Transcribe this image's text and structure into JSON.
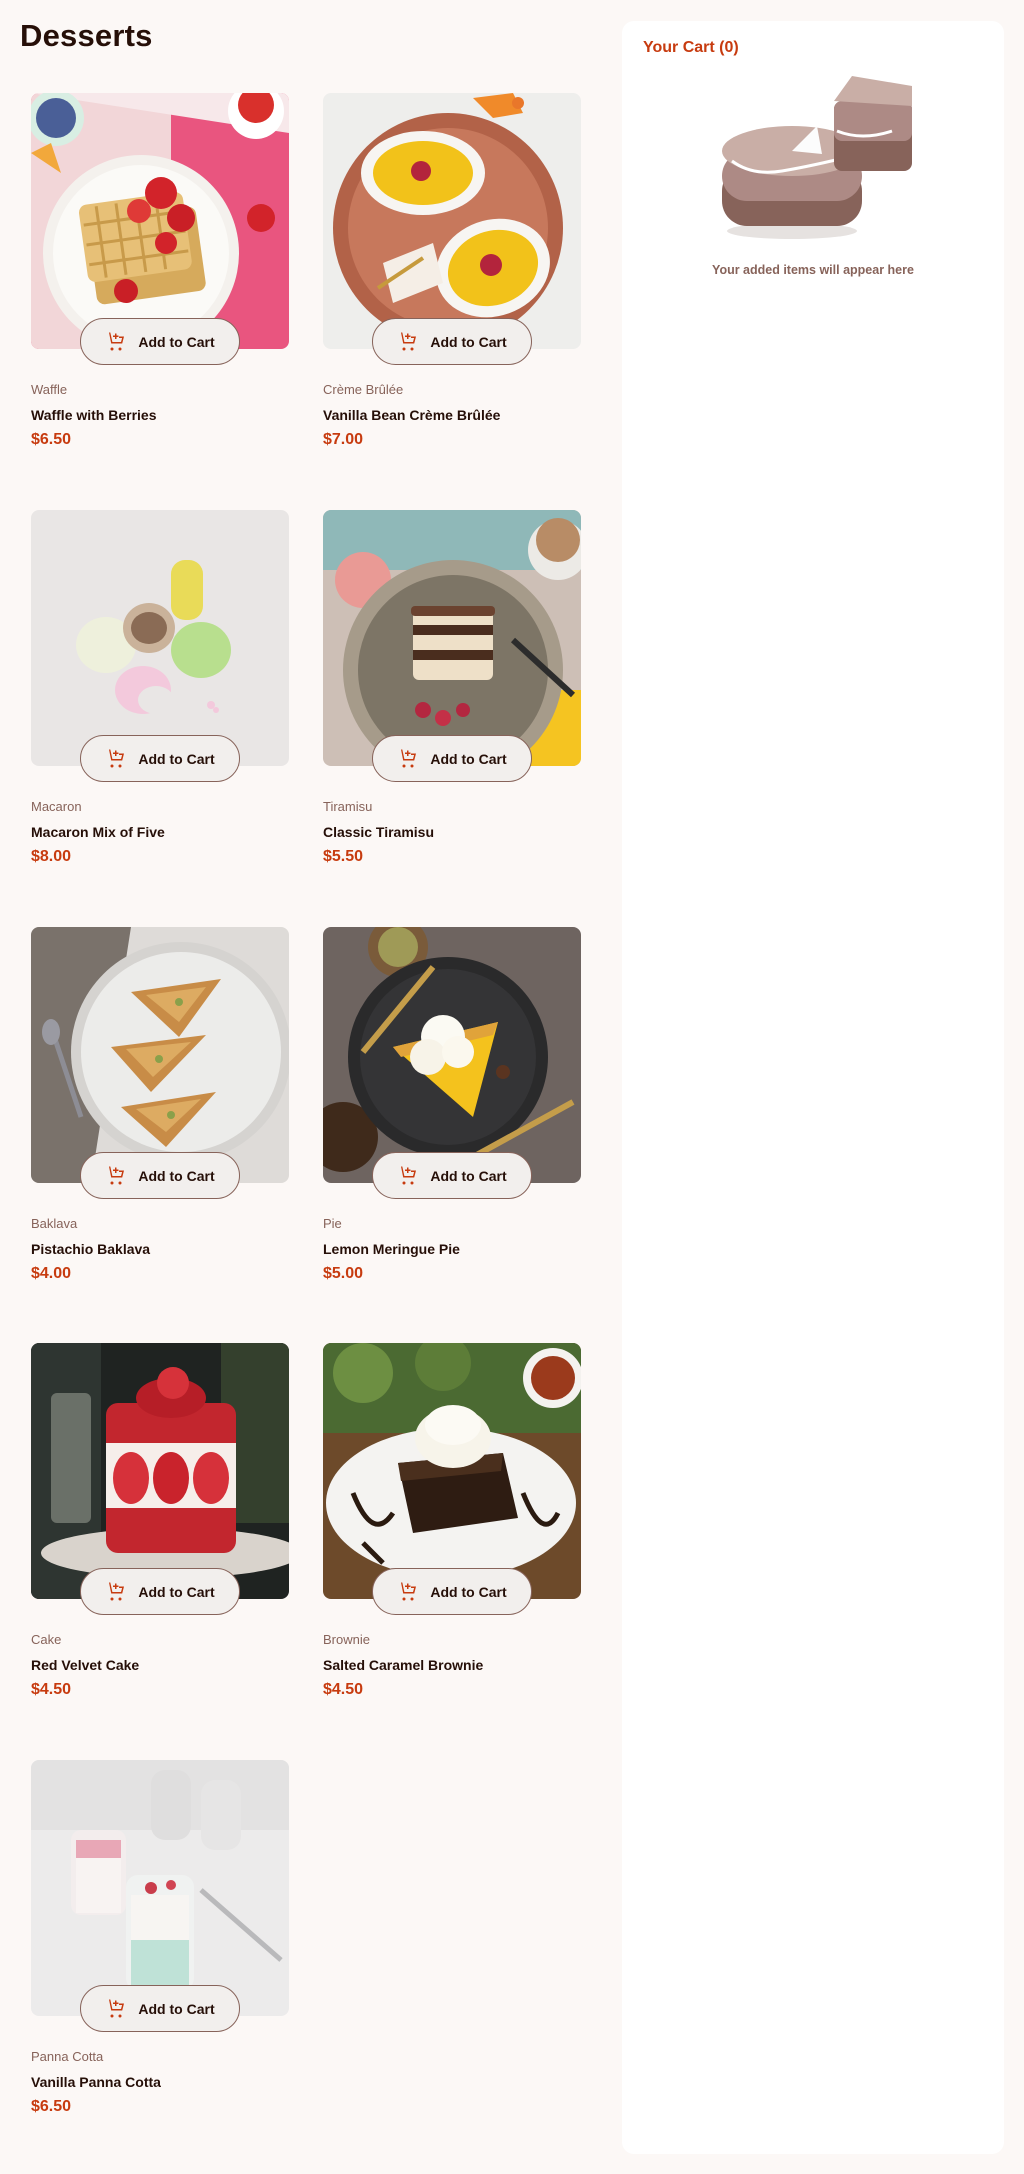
{
  "page": {
    "title": "Desserts"
  },
  "colors": {
    "accent": "#c73b0f",
    "text": "#260f08",
    "muted": "#87635a",
    "background": "#fcf8f6"
  },
  "add_to_cart_label": "Add to Cart",
  "products": [
    {
      "category": "Waffle",
      "name": "Waffle with Berries",
      "price": "$6.50"
    },
    {
      "category": "Crème Brûlée",
      "name": "Vanilla Bean Crème Brûlée",
      "price": "$7.00"
    },
    {
      "category": "Macaron",
      "name": "Macaron Mix of Five",
      "price": "$8.00"
    },
    {
      "category": "Tiramisu",
      "name": "Classic Tiramisu",
      "price": "$5.50"
    },
    {
      "category": "Baklava",
      "name": "Pistachio Baklava",
      "price": "$4.00"
    },
    {
      "category": "Pie",
      "name": "Lemon Meringue Pie",
      "price": "$5.00"
    },
    {
      "category": "Cake",
      "name": "Red Velvet Cake",
      "price": "$4.50"
    },
    {
      "category": "Brownie",
      "name": "Salted Caramel Brownie",
      "price": "$4.50"
    },
    {
      "category": "Panna Cotta",
      "name": "Vanilla Panna Cotta",
      "price": "$6.50"
    }
  ],
  "cart": {
    "title": "Your Cart (0)",
    "empty_message": "Your added items will appear here",
    "illustration_icon": "empty-cart-cake-illustration"
  },
  "icons": {
    "cart": "add-to-cart-icon"
  }
}
